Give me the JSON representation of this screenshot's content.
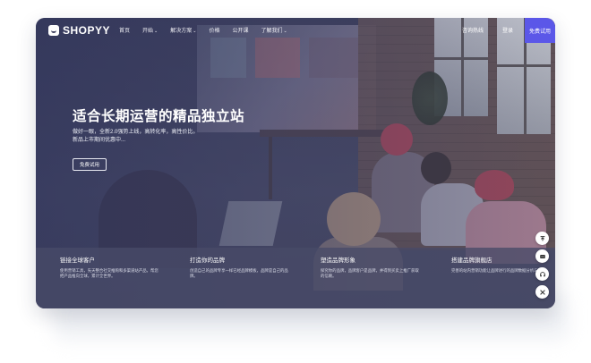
{
  "header": {
    "logo_text": "SHOPYY",
    "nav": [
      {
        "label": "首页",
        "caret": ""
      },
      {
        "label": "开始",
        "caret": "⌄"
      },
      {
        "label": "解决方案",
        "caret": "⌄"
      },
      {
        "label": "价格",
        "caret": ""
      },
      {
        "label": "公开课",
        "caret": ""
      },
      {
        "label": "了解我们",
        "caret": "⌄"
      }
    ],
    "phone_label": "咨询热线",
    "login_label": "登录",
    "trial_label": "免费试用"
  },
  "hero": {
    "title": "适合长期运营的精品独立站",
    "subtitle_line1": "做好一眼，全新2.0强势上线，高转化率，高性价比。",
    "subtitle_line2": "新品上市期间优惠中...",
    "button_label": "免费试用"
  },
  "features": [
    {
      "title": "链接全球客户",
      "desc": "使用营销工具，先天整合社交推购和多渠道站产品，帮您把产品推向全球，累计全世界。"
    },
    {
      "title": "打造你的品牌",
      "desc": "创造自己的品牌专享一样已经品牌模板，品牌是自己的品牌。"
    },
    {
      "title": "塑造品牌形象",
      "desc": "探究你的品牌，品牌客户是品牌，并得到买卖上推广获取的信赖。"
    },
    {
      "title": "搭建品牌旗舰店",
      "desc": "完善的站内营销功能让品牌进行的品牌数据分析与服务。"
    }
  ],
  "side_buttons": [
    "top-icon",
    "chat-icon",
    "headset-icon",
    "tools-icon"
  ],
  "colors": {
    "accent": "#5b57e8",
    "overlay": "#3c3f5c"
  }
}
